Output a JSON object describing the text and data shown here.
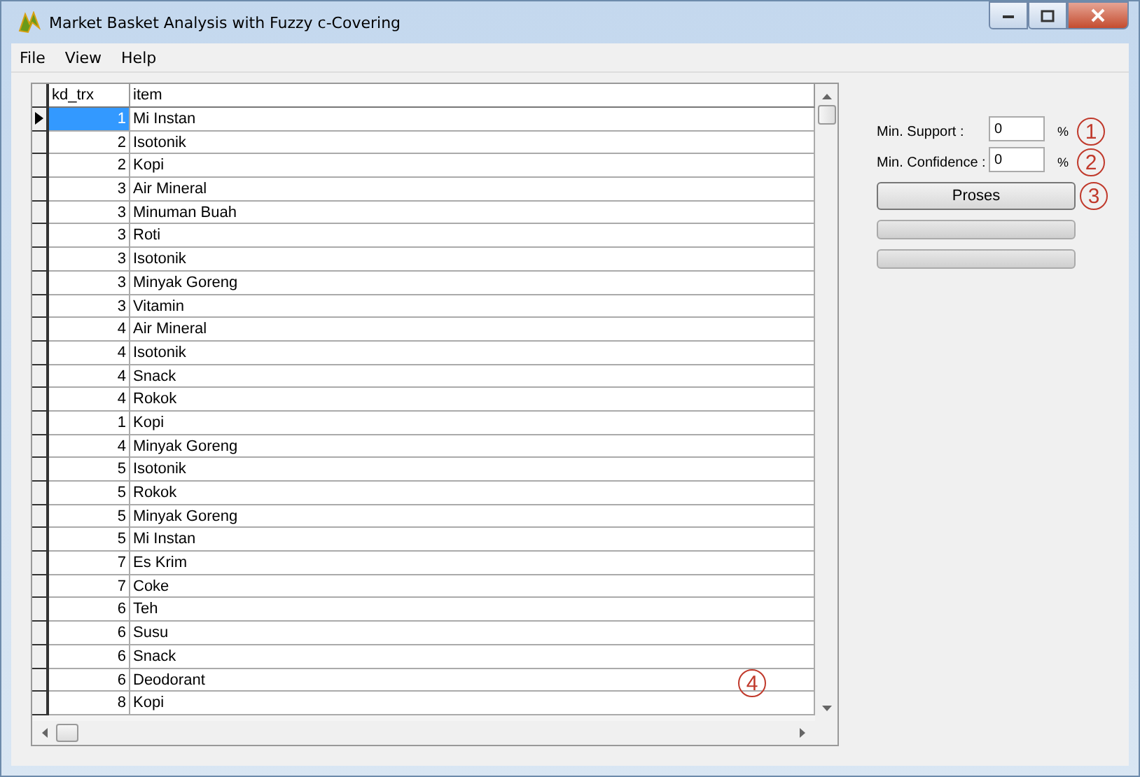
{
  "window": {
    "title": "Market Basket Analysis with Fuzzy c-Covering"
  },
  "menu": [
    "File",
    "View",
    "Help"
  ],
  "table": {
    "columns": [
      "kd_trx",
      "item"
    ],
    "rows": [
      {
        "kd_trx": "1",
        "item": "Mi Instan",
        "selected": true
      },
      {
        "kd_trx": "2",
        "item": "Isotonik",
        "selected": false
      },
      {
        "kd_trx": "2",
        "item": "Kopi",
        "selected": false
      },
      {
        "kd_trx": "3",
        "item": "Air Mineral",
        "selected": false
      },
      {
        "kd_trx": "3",
        "item": "Minuman Buah",
        "selected": false
      },
      {
        "kd_trx": "3",
        "item": "Roti",
        "selected": false
      },
      {
        "kd_trx": "3",
        "item": "Isotonik",
        "selected": false
      },
      {
        "kd_trx": "3",
        "item": "Minyak Goreng",
        "selected": false
      },
      {
        "kd_trx": "3",
        "item": "Vitamin",
        "selected": false
      },
      {
        "kd_trx": "4",
        "item": "Air Mineral",
        "selected": false
      },
      {
        "kd_trx": "4",
        "item": "Isotonik",
        "selected": false
      },
      {
        "kd_trx": "4",
        "item": "Snack",
        "selected": false
      },
      {
        "kd_trx": "4",
        "item": "Rokok",
        "selected": false
      },
      {
        "kd_trx": "1",
        "item": "Kopi",
        "selected": false
      },
      {
        "kd_trx": "4",
        "item": "Minyak Goreng",
        "selected": false
      },
      {
        "kd_trx": "5",
        "item": "Isotonik",
        "selected": false
      },
      {
        "kd_trx": "5",
        "item": "Rokok",
        "selected": false
      },
      {
        "kd_trx": "5",
        "item": "Minyak Goreng",
        "selected": false
      },
      {
        "kd_trx": "5",
        "item": "Mi Instan",
        "selected": false
      },
      {
        "kd_trx": "7",
        "item": "Es Krim",
        "selected": false
      },
      {
        "kd_trx": "7",
        "item": "Coke",
        "selected": false
      },
      {
        "kd_trx": "6",
        "item": "Teh",
        "selected": false
      },
      {
        "kd_trx": "6",
        "item": "Susu",
        "selected": false
      },
      {
        "kd_trx": "6",
        "item": "Snack",
        "selected": false
      },
      {
        "kd_trx": "6",
        "item": "Deodorant",
        "selected": false
      },
      {
        "kd_trx": "8",
        "item": "Kopi",
        "selected": false
      }
    ]
  },
  "settings": [
    {
      "label": "Min. Support :",
      "value": "0",
      "unit": "%"
    },
    {
      "label": "Min. Confidence :",
      "value": "0",
      "unit": "%"
    }
  ],
  "process_button": "Proses",
  "progress_bars": [
    {
      "level": 0
    },
    {
      "level": 0
    }
  ],
  "annotations": [
    "1",
    "2",
    "3",
    "4"
  ]
}
